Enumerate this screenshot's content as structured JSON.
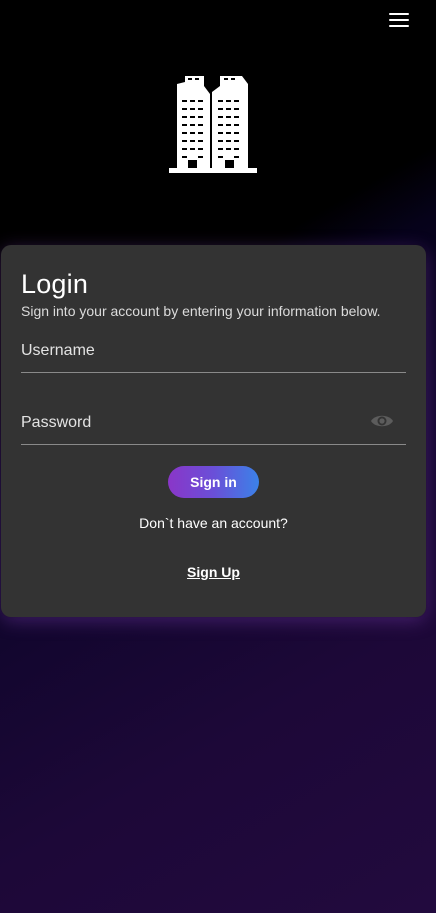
{
  "header": {
    "menu_icon": "hamburger-menu-icon"
  },
  "logo": {
    "icon": "office-buildings-icon"
  },
  "login": {
    "title": "Login",
    "subtitle": "Sign into your account by entering your information below.",
    "username": {
      "placeholder": "Username",
      "value": ""
    },
    "password": {
      "placeholder": "Password",
      "value": "",
      "toggle_icon": "eye-icon"
    },
    "signin_label": "Sign in",
    "no_account_text": "Don`t have an account?",
    "signup_label": "Sign Up"
  },
  "colors": {
    "card_bg": "#333333",
    "button_gradient_start": "#8a36c8",
    "button_gradient_end": "#3b82e8",
    "background": "#000000",
    "background_purple": "#220a3e"
  }
}
